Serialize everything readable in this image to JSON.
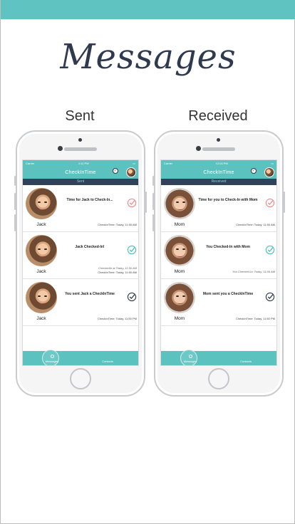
{
  "page": {
    "title": "Messages"
  },
  "columns": [
    {
      "label": "Sent",
      "screen": {
        "carrier": "Carrier",
        "clock": "1:11 PM",
        "app_title": "CheckInTime",
        "segment": "Sent",
        "rows": [
          {
            "name": "Jack",
            "message": "Time for Jack to Check-In...",
            "time_lines": [
              "CheckInTime: Today, 11:50 AM"
            ],
            "status": "pending",
            "avatar": "jack"
          },
          {
            "name": "Jack",
            "message": "Jack Checked-In!",
            "time_lines": [
              "CheckedIn at Today, 11:50 AM",
              "CheckInTime: Today, 11:50 AM"
            ],
            "status": "checked",
            "avatar": "jack"
          },
          {
            "name": "Jack",
            "message": "You sent Jack a CheckInTime",
            "time_lines": [
              "CheckInTime: Today, 11:50 PM"
            ],
            "status": "sent",
            "avatar": "jack"
          }
        ],
        "tabs": {
          "messages": "Messages",
          "contacts": "Contacts"
        }
      }
    },
    {
      "label": "Received",
      "screen": {
        "carrier": "Carrier",
        "clock": "12:04 PM",
        "app_title": "CheckInTime",
        "segment": "Received",
        "rows": [
          {
            "name": "Mom",
            "message": "Time for you to Check-In with Mom",
            "time_lines": [
              "CheckInTime: Today, 11:50 AM"
            ],
            "status": "pending",
            "avatar": "mom"
          },
          {
            "name": "Mom",
            "message": "You Checked-In with Mom",
            "time_lines": [
              "You Checked-In: Today, 11:06 AM"
            ],
            "status": "checked",
            "avatar": "mom"
          },
          {
            "name": "Mom",
            "message": "Mom sent you a CheckInTime",
            "time_lines": [
              "CheckInTime: Today, 11:50 PM"
            ],
            "status": "sent",
            "avatar": "mom"
          }
        ],
        "tabs": {
          "messages": "Messages",
          "contacts": "Contacts"
        }
      }
    }
  ],
  "colors": {
    "accent": "#5bc2c0",
    "title": "#2f3a4e",
    "pending": "#f08b8b",
    "checked": "#49bfc0",
    "sent": "#2d3a4b"
  }
}
